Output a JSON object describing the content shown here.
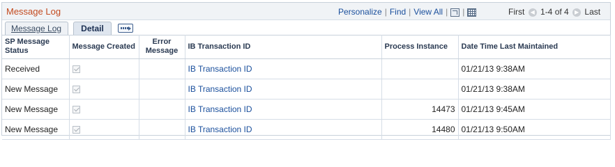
{
  "grid_title": "Message Log",
  "toolbar": {
    "personalize": "Personalize",
    "find": "Find",
    "view_all": "View All",
    "zoom_icon": "zoom-icon",
    "grid_icon": "spreadsheet-icon"
  },
  "pager": {
    "first": "First",
    "range": "1-4 of 4",
    "last": "Last"
  },
  "tabs": [
    {
      "label": "Message Log",
      "active": false
    },
    {
      "label": "Detail",
      "active": true
    }
  ],
  "columns": [
    "SP Message Status",
    "Message Created",
    "Error Message",
    "IB Transaction ID",
    "Process Instance",
    "Date Time Last Maintained"
  ],
  "rows": [
    {
      "status": "Received",
      "created": true,
      "error": "",
      "ib": "IB Transaction ID",
      "process": "",
      "datetime": "01/21/13  9:38AM"
    },
    {
      "status": "New Message",
      "created": true,
      "error": "",
      "ib": "IB Transaction ID",
      "process": "",
      "datetime": "01/21/13  9:38AM"
    },
    {
      "status": "New Message",
      "created": true,
      "error": "",
      "ib": "IB Transaction ID",
      "process": "14473",
      "datetime": "01/21/13  9:45AM"
    },
    {
      "status": "New Message",
      "created": true,
      "error": "",
      "ib": "IB Transaction ID",
      "process": "14480",
      "datetime": "01/21/13  9:50AM"
    }
  ]
}
